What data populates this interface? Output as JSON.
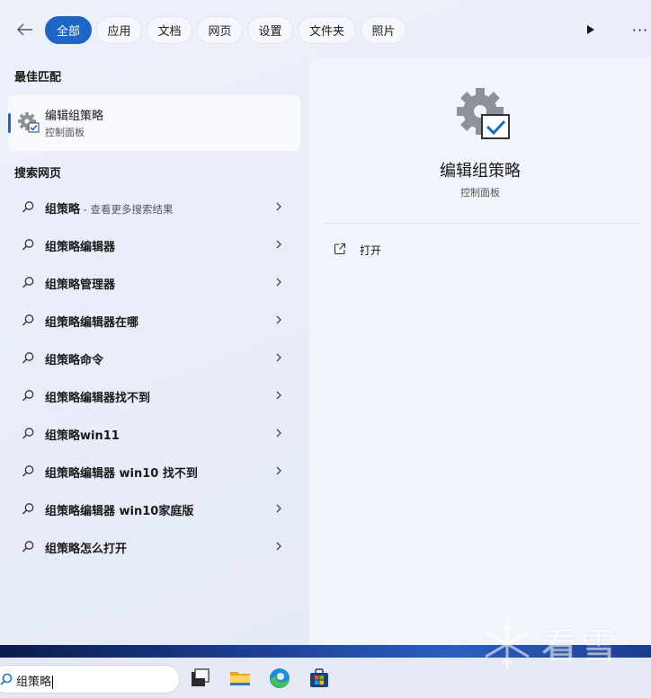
{
  "filters": {
    "tabs": [
      "全部",
      "应用",
      "文档",
      "网页",
      "设置",
      "文件夹",
      "照片"
    ],
    "active_index": 0
  },
  "best_match": {
    "section_title": "最佳匹配",
    "name": "编辑组策略",
    "subtitle": "控制面板",
    "icon": "group-policy-gear-icon"
  },
  "web_search": {
    "section_title": "搜索网页",
    "items": [
      {
        "label": "组策略",
        "hint": " - 查看更多搜索结果"
      },
      {
        "label": "组策略编辑器",
        "hint": ""
      },
      {
        "label": "组策略管理器",
        "hint": ""
      },
      {
        "label": "组策略编辑器在哪",
        "hint": ""
      },
      {
        "label": "组策略命令",
        "hint": ""
      },
      {
        "label": "组策略编辑器找不到",
        "hint": ""
      },
      {
        "label": "组策略win11",
        "hint": ""
      },
      {
        "label": "组策略编辑器 win10 找不到",
        "hint": ""
      },
      {
        "label": "组策略编辑器 win10家庭版",
        "hint": ""
      },
      {
        "label": "组策略怎么打开",
        "hint": ""
      }
    ]
  },
  "preview": {
    "title": "编辑组策略",
    "subtitle": "控制面板",
    "actions": [
      {
        "label": "打开",
        "icon": "open-external-icon"
      }
    ]
  },
  "taskbar": {
    "search_value": "组策略",
    "icons": [
      "task-view-icon",
      "file-explorer-icon",
      "edge-icon",
      "store-icon"
    ]
  },
  "watermark": {
    "text": "看雪"
  },
  "colors": {
    "accent": "#1f65c4"
  }
}
